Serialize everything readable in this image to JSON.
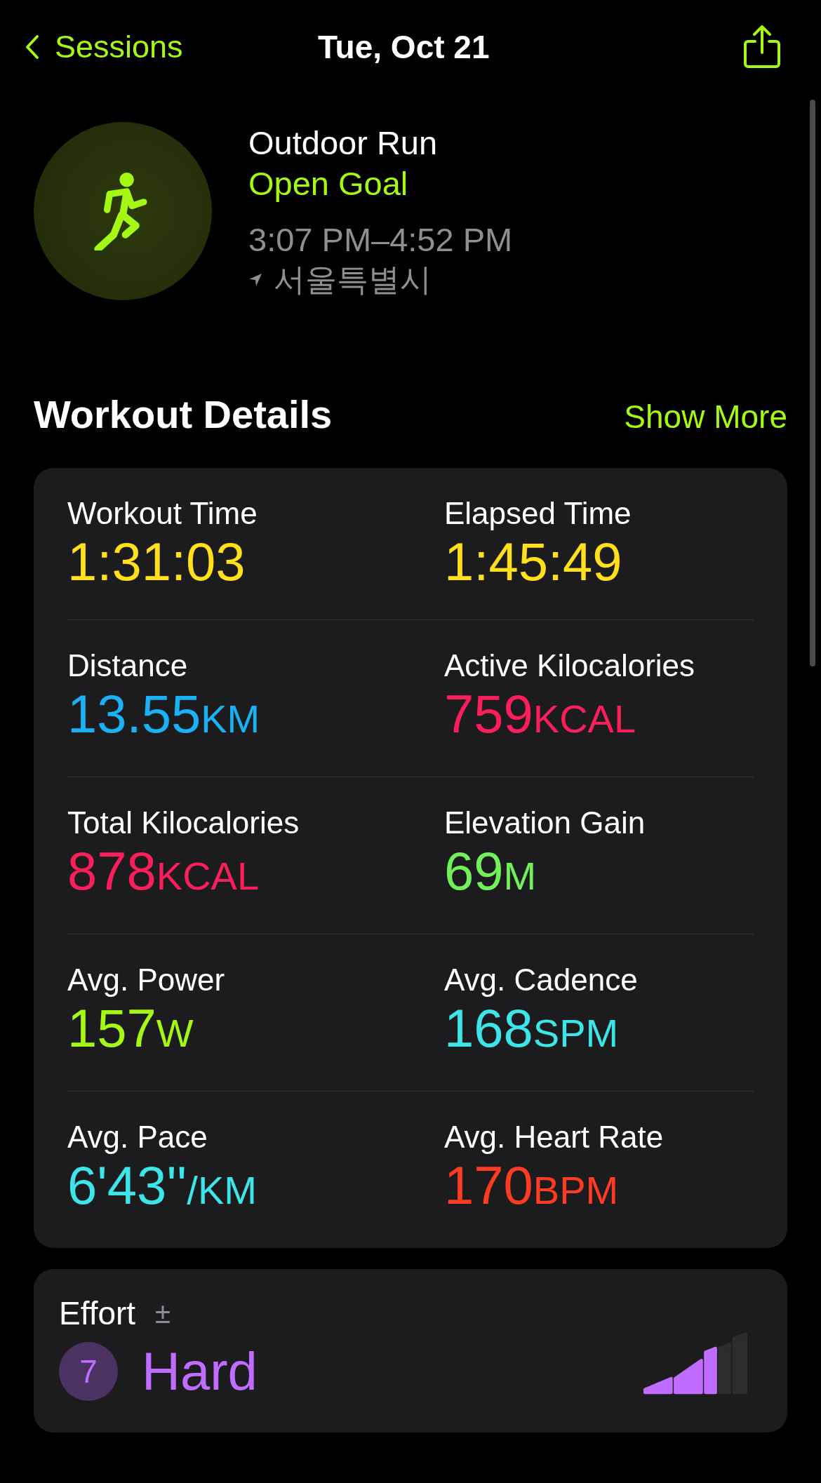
{
  "nav": {
    "back_label": "Sessions",
    "title": "Tue, Oct 21"
  },
  "workout": {
    "name": "Outdoor Run",
    "goal": "Open Goal",
    "time_range": "3:07 PM–4:52 PM",
    "location": "서울특별시"
  },
  "details": {
    "title": "Workout Details",
    "action": "Show More",
    "metrics": [
      {
        "label": "Workout Time",
        "value": "1:31:03",
        "color": "#ffe01a"
      },
      {
        "label": "Elapsed Time",
        "value": "1:45:49",
        "color": "#ffe01a"
      },
      {
        "label": "Distance",
        "value": "13.55",
        "unit": "KM",
        "color": "#1ab2f5"
      },
      {
        "label": "Active Kilocalories",
        "value": "759",
        "unit": "KCAL",
        "color": "#fa1e5a"
      },
      {
        "label": "Total Kilocalories",
        "value": "878",
        "unit": "KCAL",
        "color": "#fa1e5a"
      },
      {
        "label": "Elevation Gain",
        "value": "69",
        "unit": "M",
        "color": "#72f05a"
      },
      {
        "label": "Avg. Power",
        "value": "157",
        "unit": "W",
        "color": "#a4f813"
      },
      {
        "label": "Avg. Cadence",
        "value": "168",
        "unit": "SPM",
        "color": "#3ce6e8"
      },
      {
        "label": "Avg. Pace",
        "value": "6'43''",
        "unit": "/KM",
        "color": "#3ce6e8"
      },
      {
        "label": "Avg. Heart Rate",
        "value": "170",
        "unit": "BPM",
        "color": "#ff3b22"
      }
    ]
  },
  "effort": {
    "label": "Effort",
    "adjust": "±",
    "score": "7",
    "rating": "Hard"
  }
}
